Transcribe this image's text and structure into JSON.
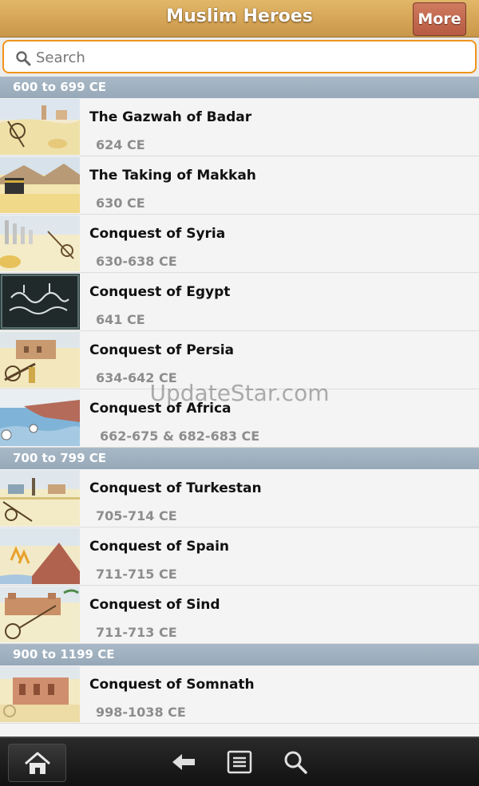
{
  "header": {
    "title": "Muslim Heroes",
    "more_label": "More"
  },
  "search": {
    "placeholder": "Search"
  },
  "sections": [
    {
      "label": "600 to 699 CE",
      "items": [
        {
          "name": "The Gazwah of Badar",
          "year": "624 CE"
        },
        {
          "name": "The Taking of Makkah",
          "year": "630 CE"
        },
        {
          "name": "Conquest of Syria",
          "year": "630-638 CE"
        },
        {
          "name": "Conquest of Egypt",
          "year": "641 CE"
        },
        {
          "name": "Conquest of Persia",
          "year": "634-642 CE"
        },
        {
          "name": "Conquest of Africa",
          "year": "662-675 & 682-683 CE"
        }
      ]
    },
    {
      "label": "700 to 799 CE",
      "items": [
        {
          "name": "Conquest of Turkestan",
          "year": "705-714 CE"
        },
        {
          "name": "Conquest of Spain",
          "year": "711-715 CE"
        },
        {
          "name": "Conquest of Sind",
          "year": "711-713 CE"
        }
      ]
    },
    {
      "label": "900 to 1199 CE",
      "items": [
        {
          "name": "Conquest of Somnath",
          "year": "998-1038 CE"
        }
      ]
    }
  ],
  "watermark": "UpdateStar.com",
  "bottom_nav": {
    "icons": [
      "home-icon",
      "back-arrow-icon",
      "list-icon",
      "search-icon"
    ]
  },
  "colors": {
    "header": "#d8a85a",
    "more_button": "#b75b42",
    "search_border": "#f0941c",
    "section_header": "#9eb0bf",
    "year_text": "#8d8d8d"
  }
}
